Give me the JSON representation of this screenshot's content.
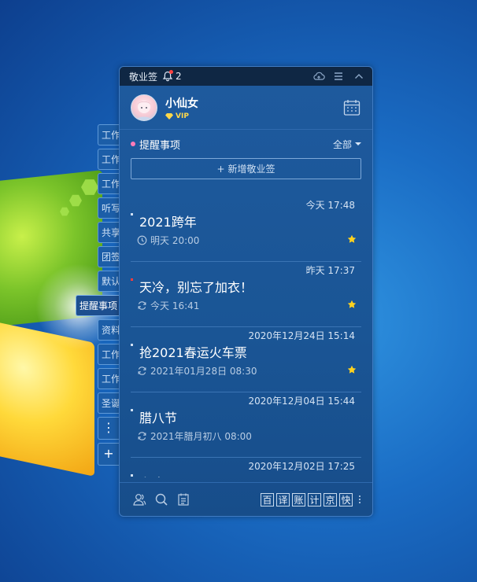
{
  "app": {
    "title": "敬业签",
    "notification_count": "2"
  },
  "user": {
    "name": "小仙女",
    "badge": "VIP"
  },
  "side_tabs": [
    "工作",
    "工作",
    "工作",
    "听写",
    "共享",
    "团签",
    "默认",
    "提醒事项",
    "资料",
    "工作",
    "工作",
    "圣诞"
  ],
  "side_tab_active": "提醒事项",
  "section": {
    "title": "提醒事项",
    "filter": "全部"
  },
  "add_button": {
    "label": "新增敬业签"
  },
  "notes": [
    {
      "time": "今天 17:48",
      "title": "2021跨年",
      "sub": "明天 20:00",
      "starred": true,
      "mark": "white",
      "icon": "clock-icon"
    },
    {
      "time": "昨天 17:37",
      "title": "天冷，别忘了加衣！",
      "sub": "今天 16:41",
      "starred": true,
      "mark": "red",
      "icon": "repeat-icon"
    },
    {
      "time": "2020年12月24日 15:14",
      "title": "抢2021春运火车票",
      "sub": "2021年01月28日 08:30",
      "starred": true,
      "mark": "white",
      "icon": "repeat-icon"
    },
    {
      "time": "2020年12月04日 15:44",
      "title": "腊八节",
      "sub": "2021年腊月初八 08:00",
      "starred": false,
      "mark": "white",
      "icon": "repeat-icon"
    },
    {
      "time": "2020年12月02日 17:25",
      "title": "上班",
      "sub": "",
      "starred": false,
      "mark": "white",
      "icon": "repeat-icon"
    }
  ],
  "footer": {
    "tools": [
      "百",
      "译",
      "账",
      "计",
      "京",
      "快"
    ]
  },
  "colors": {
    "accent": "#1e5a9e",
    "titlebar": "#0f2744",
    "star": "#ffd21f",
    "alert": "#ff3b3b"
  }
}
